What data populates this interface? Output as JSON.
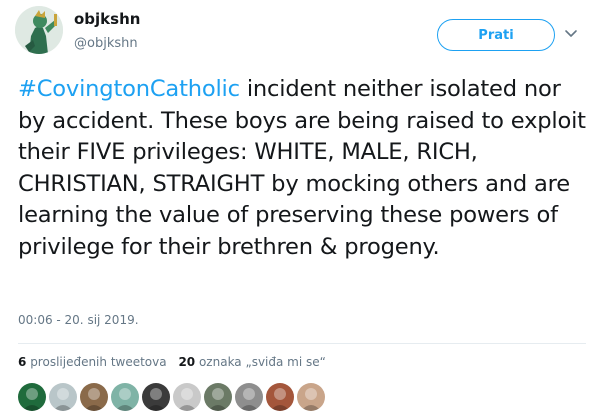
{
  "user": {
    "display_name": "objkshn",
    "handle": "@objkshn"
  },
  "follow_label": "Prati",
  "tweet": {
    "hashtag": "#CovingtonCatholic",
    "text": " incident neither isolated nor by accident. These boys are being raised to exploit their FIVE privileges: WHITE, MALE, RICH, CHRISTIAN, STRAIGHT by mocking others and are learning the value of preserving these powers of privilege for their brethren & progeny."
  },
  "timestamp": "00:06 - 20. sij 2019.",
  "stats": {
    "retweets_count": "6",
    "retweets_label": "proslijeđenih tweetova",
    "likes_count": "20",
    "likes_label": "oznaka „sviđa mi se“"
  },
  "likers": [
    {
      "icon": "liker-avatar-1",
      "color": "#1f6b3c"
    },
    {
      "icon": "liker-avatar-2",
      "color": "#b9c6c9"
    },
    {
      "icon": "liker-avatar-3",
      "color": "#8a6a4a"
    },
    {
      "icon": "liker-avatar-4",
      "color": "#7fb3a6"
    },
    {
      "icon": "liker-avatar-5",
      "color": "#3b3b3b"
    },
    {
      "icon": "liker-avatar-6",
      "color": "#c9c9c9"
    },
    {
      "icon": "liker-avatar-7",
      "color": "#6b7a66"
    },
    {
      "icon": "liker-avatar-8",
      "color": "#8e8e8e"
    },
    {
      "icon": "liker-avatar-9",
      "color": "#a4563b"
    },
    {
      "icon": "liker-avatar-10",
      "color": "#c9a58a"
    }
  ],
  "colors": {
    "accent": "#1da1f2",
    "text": "#14171a",
    "muted": "#657786"
  }
}
